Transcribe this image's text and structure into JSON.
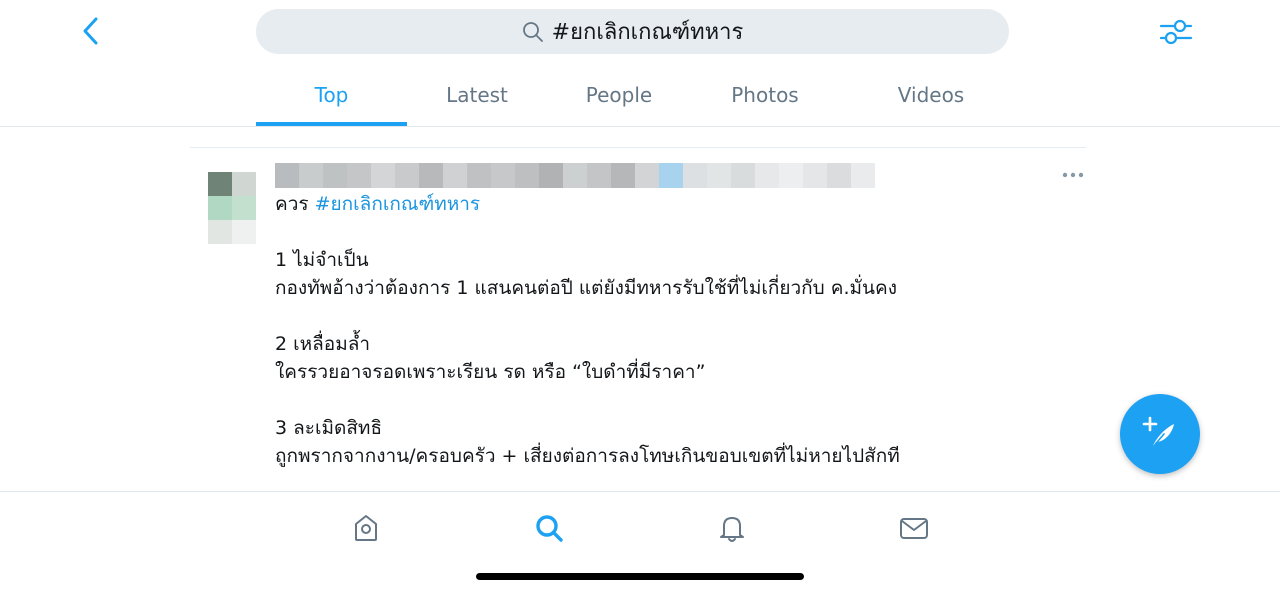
{
  "header": {
    "search_query": "#ยกเลิกเกณฑ์ทหาร",
    "back_icon": "chevron-left-icon",
    "search_icon": "search-icon",
    "filter_icon": "sliders-icon",
    "accent_color": "#1da1f2"
  },
  "tabs": [
    {
      "label": "Top",
      "active": true
    },
    {
      "label": "Latest",
      "active": false
    },
    {
      "label": "People",
      "active": false
    },
    {
      "label": "Photos",
      "active": false
    },
    {
      "label": "Videos",
      "active": false
    }
  ],
  "tweet": {
    "first_line_prefix": "ควร ",
    "hashtag": "#ยกเลิกเกณฑ์ทหาร",
    "lines": [
      "1 ไม่จำเป็น",
      "กองทัพอ้างว่าต้องการ 1 แสนคนต่อปี แต่ยังมีทหารรับใช้ที่ไม่เกี่ยวกับ ค.มั่นคง",
      "2 เหลื่อมล้ำ",
      "ใครรวยอาจรอดเพราะเรียน รด หรือ “ใบดำที่มีราคา”",
      "3 ละเมิดสิทธิ",
      "ถูกพรากจากงาน/ครอบครัว + เสี่ยงต่อการลงโทษเกินขอบเขตที่ไม่หายไปสักที"
    ],
    "more_icon": "more-horizontal-icon"
  },
  "fab": {
    "icon": "compose-tweet-icon"
  },
  "bottom_nav": [
    {
      "icon": "home-icon",
      "active": false
    },
    {
      "icon": "search-icon",
      "active": true
    },
    {
      "icon": "bell-icon",
      "active": false
    },
    {
      "icon": "mail-icon",
      "active": false
    }
  ]
}
